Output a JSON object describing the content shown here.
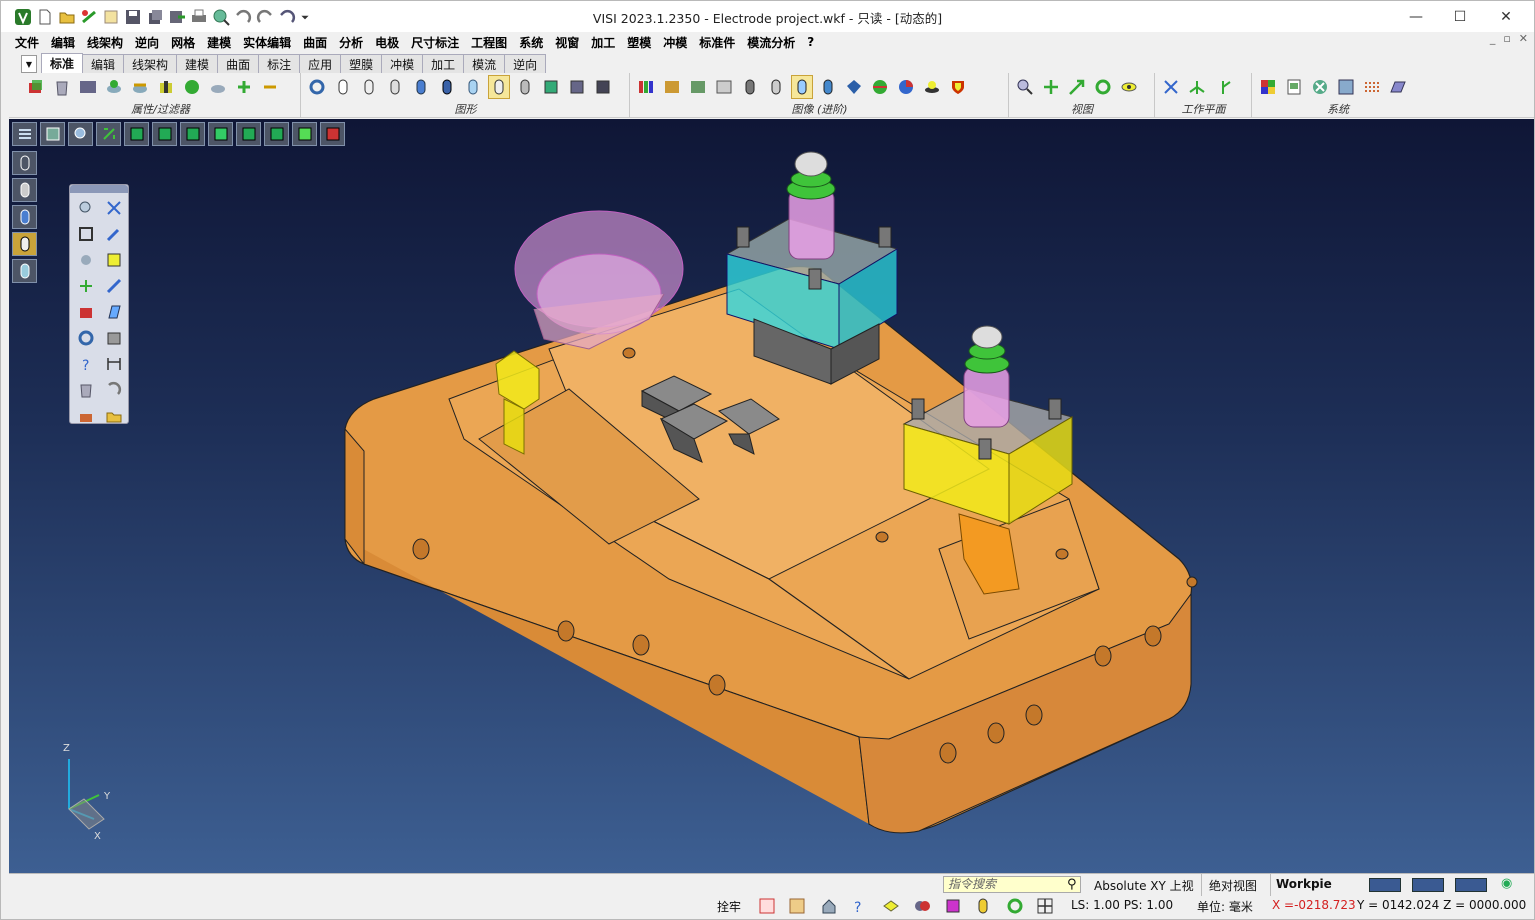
{
  "window": {
    "title": "VISI 2023.1.2350 - Electrode project.wkf - 只读 - [动态的]",
    "minimize": "—",
    "maximize": "☐",
    "close": "✕"
  },
  "menu": [
    "文件",
    "编辑",
    "线架构",
    "逆向",
    "网格",
    "建模",
    "实体编辑",
    "曲面",
    "分析",
    "电极",
    "尺寸标注",
    "工程图",
    "系统",
    "视窗",
    "加工",
    "塑模",
    "冲模",
    "标准件",
    "模流分析",
    "?"
  ],
  "mdi_controls": [
    "_",
    "▫",
    "✕"
  ],
  "tabs": [
    "标准",
    "编辑",
    "线架构",
    "建模",
    "曲面",
    "标注",
    "应用",
    "塑膜",
    "冲模",
    "加工",
    "模流",
    "逆向"
  ],
  "active_tab": "标准",
  "ribbon_groups": [
    {
      "label": "属性/过滤器"
    },
    {
      "label": "图形"
    },
    {
      "label": "图像 (进阶)"
    },
    {
      "label": "视图"
    },
    {
      "label": "工作平面"
    },
    {
      "label": "系统"
    }
  ],
  "statusbar": {
    "search_placeholder": "指令搜索",
    "view_mode": "Absolute XY 上视",
    "abs_view": "绝对视图",
    "workpiece": "Workpie",
    "snap": "拴牢",
    "ls_ps": "LS: 1.00 PS: 1.00",
    "units": "单位: 毫米",
    "x": "X =-0218.723",
    "yz": "Y = 0142.024 Z = 0000.000"
  },
  "colors": {
    "viewport_top": "#0f1636",
    "viewport_bottom": "#3d5f92",
    "part_orange": "#e9a04a",
    "electrode_cyan": "#2fd7e0",
    "electrode_yellow": "#f2ea1a",
    "pink": "#e9a0e6",
    "green": "#3fc43a",
    "coord_x": "#d42020"
  },
  "axis_labels": {
    "z": "Z",
    "y": "Y",
    "x": "X"
  }
}
